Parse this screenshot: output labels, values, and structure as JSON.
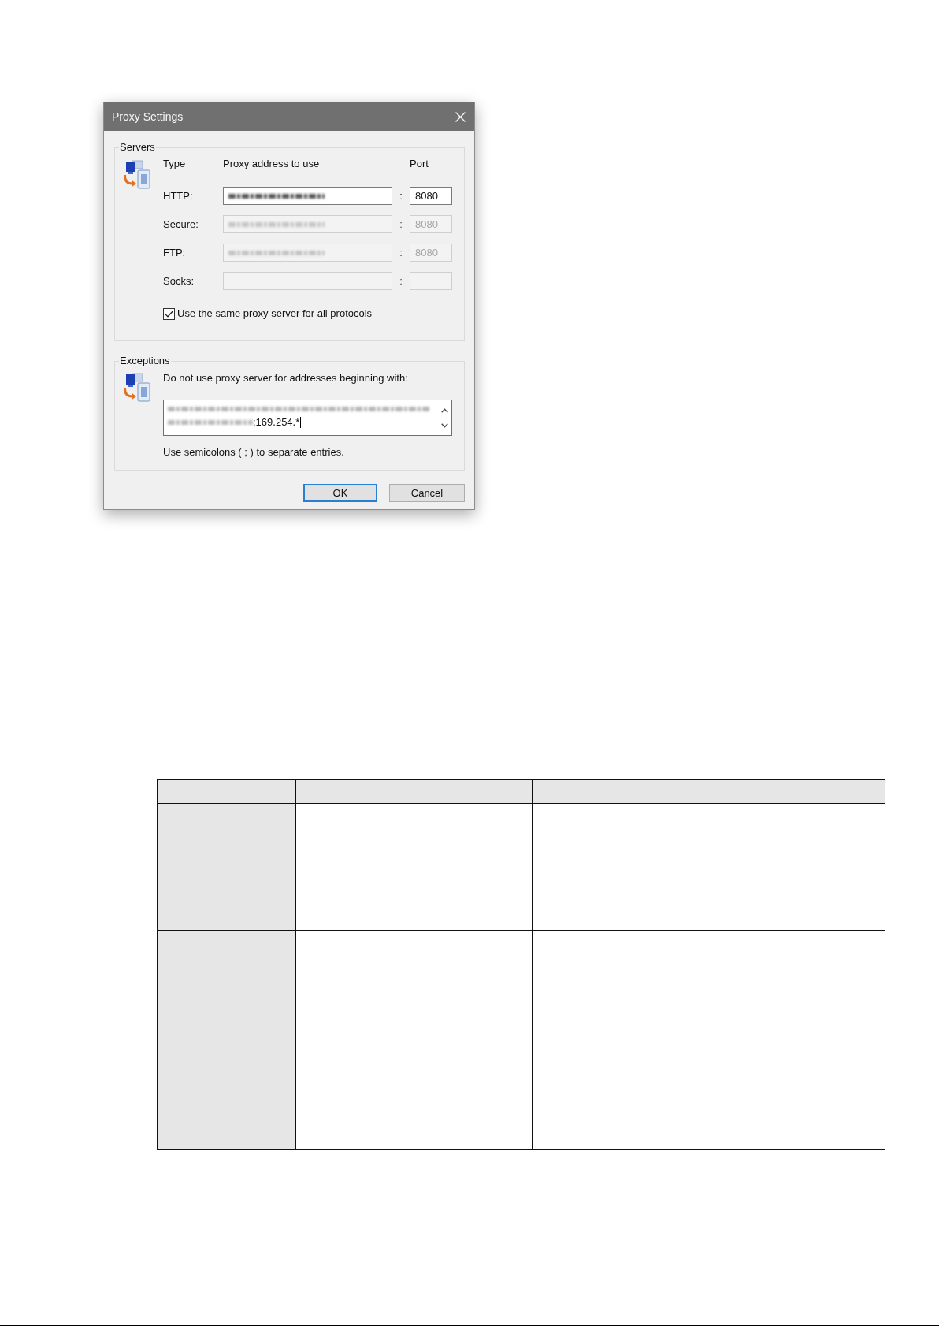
{
  "dialog": {
    "title": "Proxy Settings",
    "servers": {
      "title": "Servers",
      "headers": {
        "type": "Type",
        "address": "Proxy address to use",
        "port": "Port"
      },
      "protocols": [
        {
          "label": "HTTP:",
          "disabled": false,
          "address_redacted": true,
          "separator": ":",
          "port": "8080"
        },
        {
          "label": "Secure:",
          "disabled": true,
          "address_redacted": true,
          "separator": ":",
          "port": "8080"
        },
        {
          "label": "FTP:",
          "disabled": true,
          "address_redacted": true,
          "separator": ":",
          "port": "8080"
        },
        {
          "label": "Socks:",
          "disabled": true,
          "address_redacted": false,
          "separator": ":"
        }
      ],
      "same_proxy": {
        "label": "Use the same proxy server for all protocols",
        "checked": true
      }
    },
    "exceptions": {
      "title": "Exceptions",
      "label": "Do not use proxy server for addresses beginning with:",
      "field": {
        "redacted": true,
        "value": ";169.254.*",
        "focused": true
      },
      "hint": "Use semicolons ( ; ) to separate entries."
    },
    "buttons": [
      {
        "label": "OK",
        "default": true
      },
      {
        "label": "Cancel",
        "default": false
      }
    ]
  },
  "table": {
    "columns": [
      {
        "shaded": true
      },
      {
        "shaded": false
      },
      {
        "shaded": false
      }
    ],
    "rows": [
      {
        "shaded": true
      },
      {
        "shaded": false
      },
      {
        "shaded": false
      },
      {
        "shaded": false
      }
    ]
  }
}
